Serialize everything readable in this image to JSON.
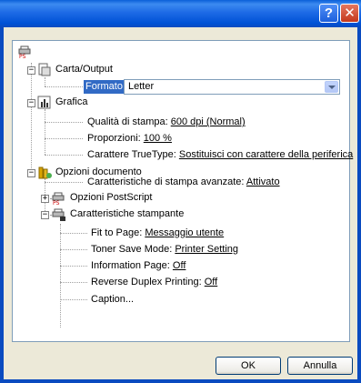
{
  "window": {
    "help_glyph": "?",
    "close_glyph": "✕"
  },
  "tree": {
    "paper": {
      "label": "Carta/Output"
    },
    "format": {
      "label": "Formato:",
      "value": "Letter"
    },
    "graphics": {
      "label": "Grafica"
    },
    "quality": {
      "label": "Qualità di stampa:",
      "value": "600 dpi (Normal)"
    },
    "scaling": {
      "label": "Proporzioni:",
      "value": "100 %"
    },
    "truetype": {
      "label": "Carattere TrueType:",
      "value": "Sostituisci con carattere della periferica"
    },
    "doc_options": {
      "label": "Opzioni documento"
    },
    "advanced": {
      "label": "Caratteristiche di stampa avanzate:",
      "value": "Attivato"
    },
    "postscript": {
      "label": "Opzioni PostScript"
    },
    "printer_features": {
      "label": "Caratteristiche stampante"
    },
    "fit": {
      "label": "Fit to Page:",
      "value": "Messaggio utente"
    },
    "toner": {
      "label": "Toner Save Mode:",
      "value": "Printer Setting"
    },
    "info": {
      "label": "Information Page:",
      "value": "Off"
    },
    "duplex": {
      "label": "Reverse Duplex Printing:",
      "value": "Off"
    },
    "caption": {
      "label": "Caption..."
    }
  },
  "buttons": {
    "ok": "OK",
    "cancel": "Annulla"
  },
  "colors": {
    "titlebar": "#0A5FD8",
    "selection": "#316AC5",
    "dialog_bg": "#ECE9D8"
  }
}
